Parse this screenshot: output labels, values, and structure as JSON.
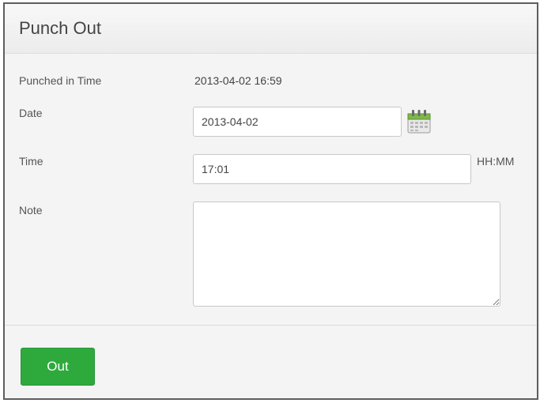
{
  "panel": {
    "title": "Punch Out"
  },
  "form": {
    "punched_in_label": "Punched in Time",
    "punched_in_value": "2013-04-02 16:59",
    "date_label": "Date",
    "date_value": "2013-04-02",
    "date_icon": "calendar-icon",
    "time_label": "Time",
    "time_value": "17:01",
    "time_hint": "HH:MM",
    "note_label": "Note",
    "note_value": ""
  },
  "actions": {
    "out_label": "Out"
  },
  "colors": {
    "button_green": "#2eaa3c",
    "border_dark": "#5e5e5e",
    "panel_bg": "#f4f4f4"
  }
}
